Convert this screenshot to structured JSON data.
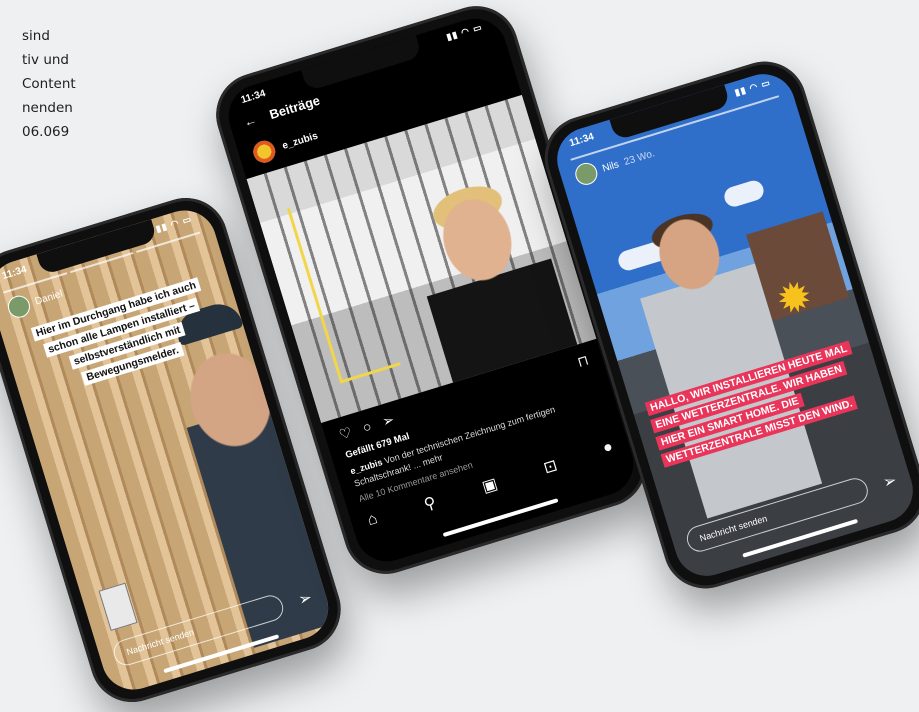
{
  "background_text": {
    "lines": [
      "sind",
      "tiv und",
      "Content",
      "nenden",
      "06.069"
    ]
  },
  "phone_left": {
    "time": "11:34",
    "username": "Daniel",
    "sticker_text": "Hier im Durchgang habe ich auch schon alle Lampen installiert – selbstverständlich mit Bewegungsmelder.",
    "reply_placeholder": "Nachricht senden"
  },
  "phone_middle": {
    "time": "11:34",
    "header_title": "Beiträge",
    "account": "e_zubis",
    "likes": "Gefällt 679 Mal",
    "caption_user": "e_zubis",
    "caption_text": "Von der technischen Zeichnung zum fertigen Schaltschrank! ... mehr",
    "comments": "Alle 10 Kommentare ansehen"
  },
  "phone_right": {
    "time": "11:34",
    "username": "Nils",
    "age": "23 Wo.",
    "sticker_text": "HALLO, WIR INSTALLIEREN HEUTE MAL EINE WETTERZENTRALE. WIR HABEN HIER EIN SMART HOME. DIE WETTERZENTRALE MISST DEN WIND.",
    "reply_placeholder": "Nachricht senden"
  },
  "colors": {
    "page_bg": "#eef0f2",
    "story_sticker_pink": "#e9355a",
    "phone_body": "#0f0f0f"
  }
}
